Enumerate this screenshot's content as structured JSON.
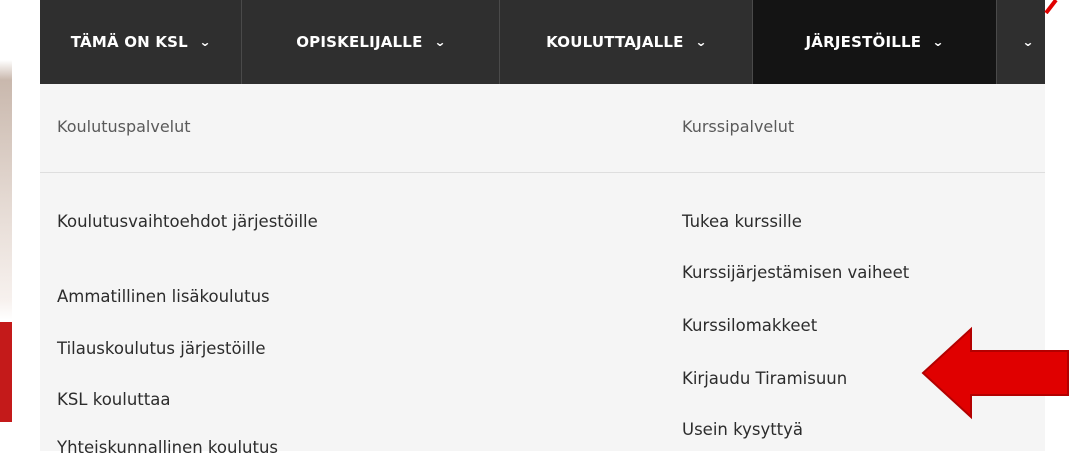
{
  "nav": {
    "items": [
      {
        "label": "TÄMÄ ON KSL",
        "icon": "chevron-down-icon",
        "active": false
      },
      {
        "label": "OPISKELIJALLE",
        "icon": "chevron-down-icon",
        "active": false
      },
      {
        "label": "KOULUTTAJALLE",
        "icon": "chevron-down-icon",
        "active": false
      },
      {
        "label": "JÄRJESTÖILLE",
        "icon": "chevron-down-icon",
        "active": true
      },
      {
        "label": "",
        "icon": "chevron-down-icon",
        "active": false
      }
    ]
  },
  "dropdown": {
    "left_column": {
      "title": "Koulutuspalvelut",
      "links": [
        "Koulutusvaihtoehdot järjestöille",
        "Ammatillinen lisäkoulutus",
        "Tilauskoulutus järjestöille",
        "KSL kouluttaa",
        "Yhteiskunnallinen koulutus"
      ]
    },
    "right_column": {
      "title": "Kurssipalvelut",
      "links": [
        "Tukea kurssille",
        "Kurssijärjestämisen vaiheet",
        "Kurssilomakkeet",
        "Kirjaudu Tiramisuun",
        "Usein kysyttyä"
      ]
    }
  },
  "annotation": {
    "arrow_icon": "left-arrow-icon",
    "arrow_color": "#e00000"
  },
  "colors": {
    "nav_bg": "#2f2f2f",
    "nav_active_bg": "#141414",
    "panel_bg": "#f5f5f5",
    "accent_red": "#e00000"
  }
}
